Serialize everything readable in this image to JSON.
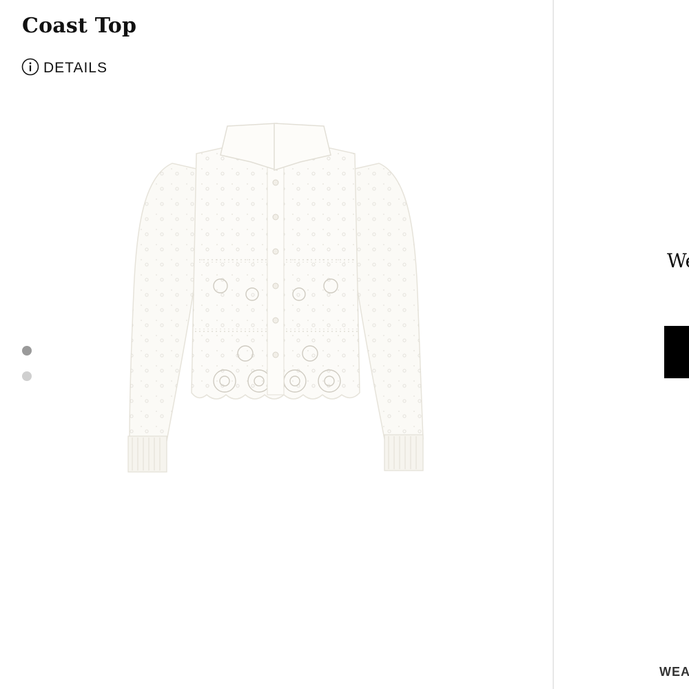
{
  "product": {
    "title": "Coast Top",
    "details_label": "DETAILS",
    "image_alt": "White eyelet button-down blouse with long sleeves"
  },
  "carousel": {
    "active_index": 0,
    "dots": [
      {
        "color": "#9a9a9a"
      },
      {
        "color": "#cfcfcf"
      }
    ]
  },
  "side_panel": {
    "teaser_text": "We",
    "footer_text": "WEA"
  },
  "colors": {
    "background": "#ffffff",
    "text": "#111111",
    "divider": "#e8e8e8",
    "button": "#000000"
  },
  "icons": {
    "details": "info-circle-icon"
  }
}
